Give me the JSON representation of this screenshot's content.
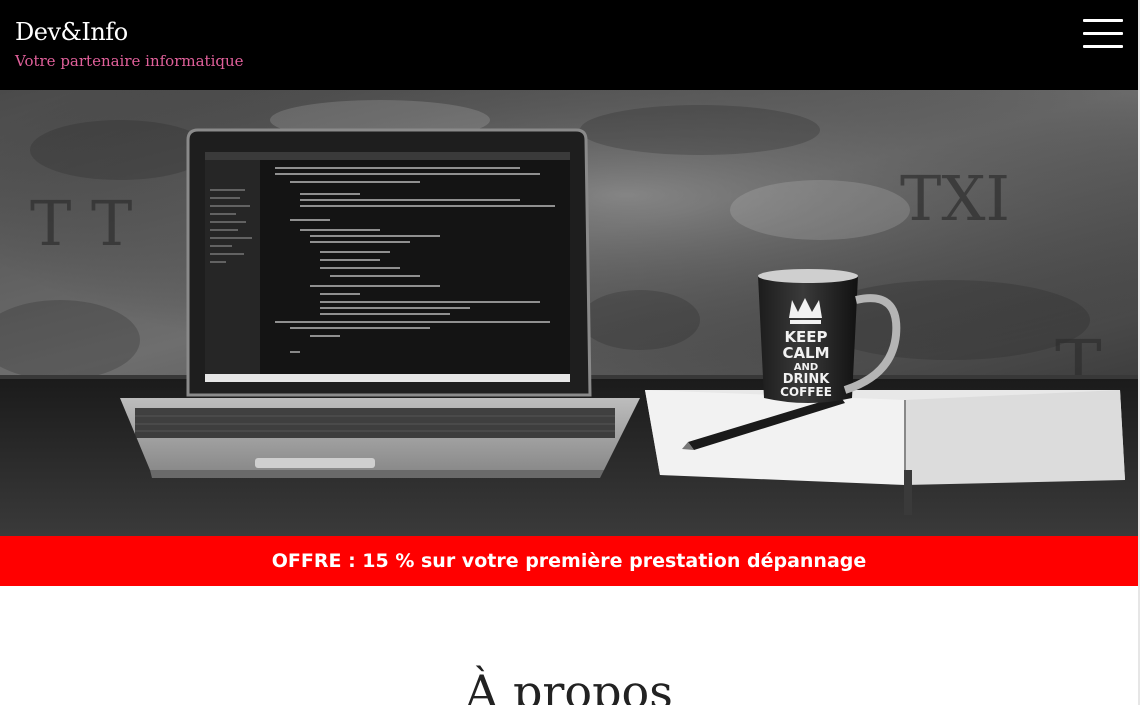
{
  "header": {
    "brand_title": "Dev&Info",
    "tagline": "Votre partenaire informatique",
    "menu_icon": "hamburger-icon"
  },
  "hero": {
    "mug_text": [
      "KEEP",
      "CALM",
      "AND",
      "DRINK",
      "COFFEE"
    ]
  },
  "offer": {
    "text": "OFFRE : 15 % sur votre première prestation dépannage"
  },
  "about": {
    "title": "À propos"
  },
  "colors": {
    "header_bg": "#000000",
    "tagline": "#e0609a",
    "offer_bg": "#ff0000"
  }
}
